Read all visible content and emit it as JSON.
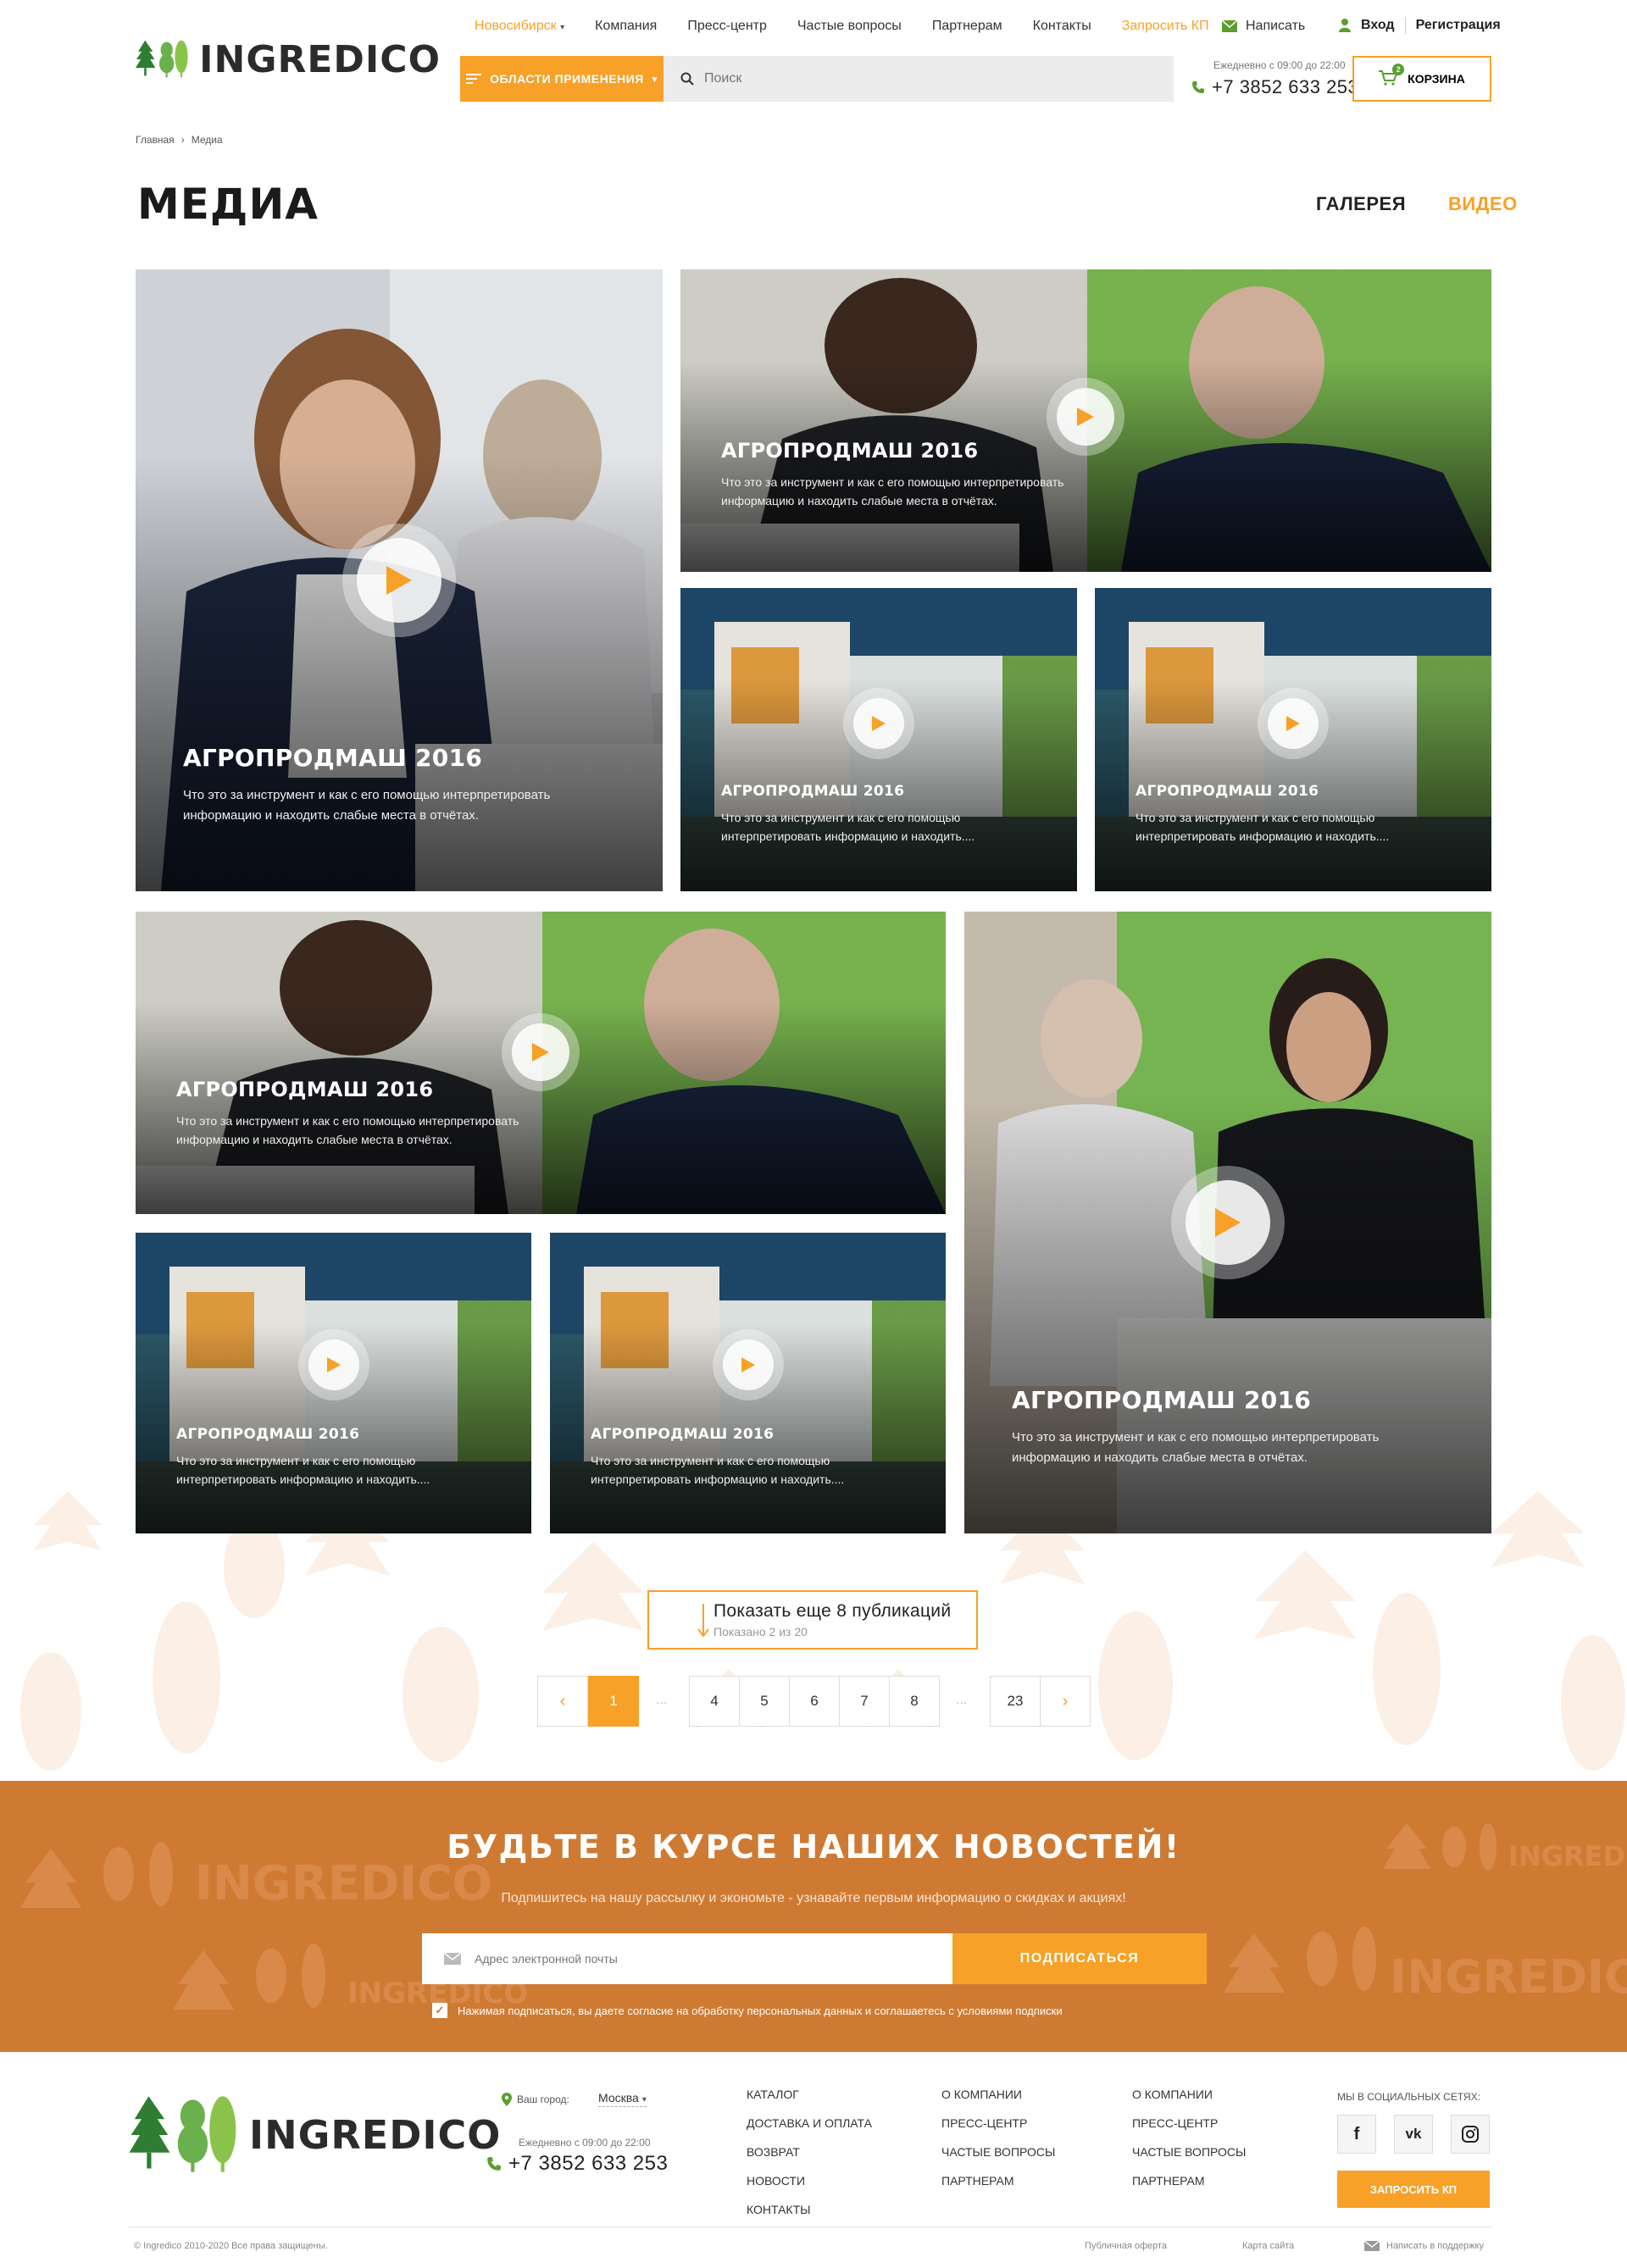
{
  "header": {
    "logo_text": "INGREDICO",
    "city": "Новосибирск",
    "nav": [
      "Компания",
      "Пресс-центр",
      "Частые вопросы",
      "Партнерам",
      "Контакты"
    ],
    "request_kp": "Запросить КП",
    "write": "Написать",
    "login": "Вход",
    "register": "Регистрация",
    "areas_label": "Области применения",
    "search_placeholder": "Поиск",
    "hours": "Ежедневно с 09:00 до 22:00",
    "phone": "+7 3852 633 253",
    "cart_label": "КОРЗИНА",
    "cart_count": "2"
  },
  "breadcrumb": {
    "home": "Главная",
    "sep": "›",
    "current": "Медиа"
  },
  "page": {
    "title": "МЕДИА",
    "tab_gallery": "ГАЛЕРЕЯ",
    "tab_video": "ВИДЕО"
  },
  "cards": [
    {
      "title": "АГРОПРОДМАШ 2016",
      "desc": "Что это за инструмент и как с его помощью интерпретировать информацию и находить слабые места в отчётах."
    },
    {
      "title": "АГРОПРОДМАШ 2016",
      "desc": "Что это за инструмент и как с его помощью интерпретировать информацию и находить слабые места в отчётах."
    },
    {
      "title": "АГРОПРОДМАШ 2016",
      "desc": "Что это за инструмент и как с его помощью интерпретировать информацию и находить...."
    },
    {
      "title": "АГРОПРОДМАШ 2016",
      "desc": "Что это за инструмент и как с его помощью интерпретировать информацию и находить...."
    },
    {
      "title": "АГРОПРОДМАШ 2016",
      "desc": "Что это за инструмент и как с его помощью интерпретировать информацию и находить слабые места в отчётах."
    },
    {
      "title": "АГРОПРОДМАШ 2016",
      "desc": "Что это за инструмент и как с его помощью интерпретировать информацию и находить слабые места в отчётах."
    },
    {
      "title": "АГРОПРОДМАШ 2016",
      "desc": "Что это за инструмент и как с его помощью интерпретировать информацию и находить...."
    },
    {
      "title": "АГРОПРОДМАШ 2016",
      "desc": "Что это за инструмент и как с его помощью интерпретировать информацию и находить...."
    }
  ],
  "show_more": {
    "label": "Показать еще 8 публикаций",
    "shown": "Показано 2 из 20"
  },
  "pagination": {
    "prev": "‹",
    "next": "›",
    "pages": [
      "1",
      "4",
      "5",
      "6",
      "7",
      "8",
      "23"
    ],
    "ellipsis": "..."
  },
  "subscribe": {
    "title": "БУДЬТЕ В КУРСЕ НАШИХ НОВОСТЕЙ!",
    "text": "Подпишитесь на нашу рассылку и экономьте - узнавайте первым информацию о скидках и акциях!",
    "email_placeholder": "Адрес электронной почты",
    "button": "ПОДПИСАТЬСЯ",
    "consent": "Нажимая подписаться, вы даете согласие на обработку персональных данных и соглашаетесь с условиями подписки",
    "watermark": "INGREDICO"
  },
  "footer": {
    "city_label": "Ваш город:",
    "city": "Москва",
    "hours": "Ежедневно с 09:00 до 22:00",
    "phone": "+7 3852 633 253",
    "col1": [
      "КАТАЛОГ",
      "ДОСТАВКА И ОПЛАТА",
      "ВОЗВРАТ",
      "НОВОСТИ",
      "КОНТАКТЫ"
    ],
    "col2": [
      "О КОМПАНИИ",
      "ПРЕСС-ЦЕНТР",
      "ЧАСТЫЕ ВОПРОСЫ",
      "ПАРТНЕРАМ"
    ],
    "col3": [
      "О КОМПАНИИ",
      "ПРЕСС-ЦЕНТР",
      "ЧАСТЫЕ ВОПРОСЫ",
      "ПАРТНЕРАМ"
    ],
    "social_label": "МЫ В СОЦИАЛЬНЫХ СЕТЯХ:",
    "social": [
      "f",
      "vk"
    ],
    "request_kp": "ЗАПРОСИТЬ КП",
    "copyright": "© Ingredico 2010-2020 Все права защищены.",
    "offer": "Публичная оферта",
    "sitemap": "Карта сайта",
    "support": "Написать в поддержку"
  },
  "colors": {
    "accent": "#f7a128",
    "subscribe_bg": "#cf7a33",
    "green": "#5a9e2f"
  }
}
